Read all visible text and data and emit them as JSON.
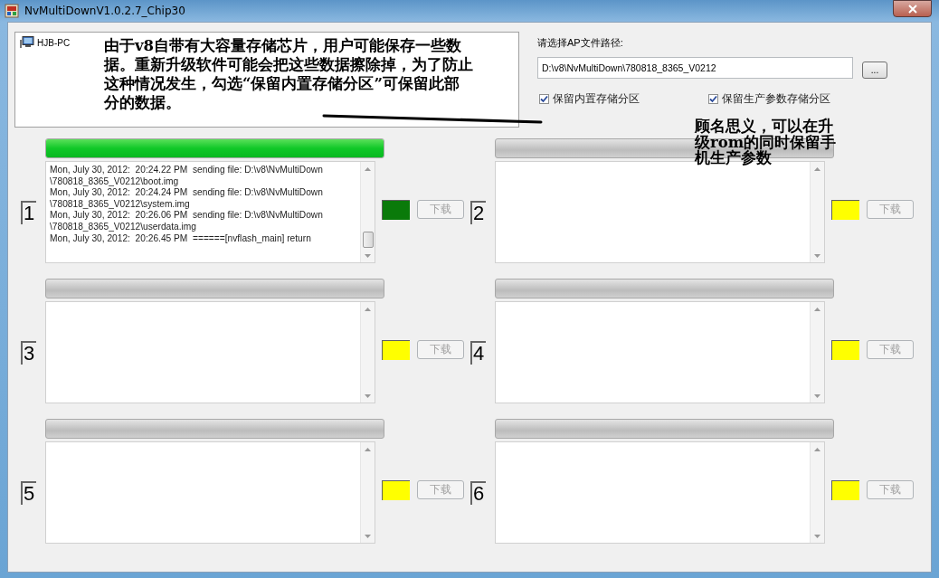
{
  "window": {
    "title": "NvMultiDownV1.0.2.7_Chip30"
  },
  "device_tree": {
    "items": [
      {
        "label": "HJB-PC"
      }
    ]
  },
  "path_label": "请选择AP文件路径:",
  "path_field": {
    "value": "D:\\v8\\NvMultiDown\\780818_8365_V0212"
  },
  "browse_button": "...",
  "options": [
    {
      "label": "保留内置存储分区",
      "checked": true
    },
    {
      "label": "保留生产参数存储分区",
      "checked": true
    }
  ],
  "slots": [
    {
      "number": "1",
      "level": 1,
      "log": [
        "Mon, July 30, 2012:  20:24.22 PM  sending file: D:\\v8\\NvMultiDown",
        "\\780818_8365_V0212\\boot.img",
        "Mon, July 30, 2012:  20:24.24 PM  sending file: D:\\v8\\NvMultiDown",
        "\\780818_8365_V0212\\system.img",
        "Mon, July 30, 2012:  20:26.06 PM  sending file: D:\\v8\\NvMultiDown",
        "\\780818_8365_V0212\\userdata.img",
        "Mon, July 30, 2012:  20:26.45 PM  ======[nvflash_main] return"
      ],
      "color": "#0a7a0a",
      "button": {
        "label": "下载",
        "disabled": true
      }
    },
    {
      "number": "2",
      "level": 0,
      "color": "#ffff00",
      "button": {
        "label": "下载",
        "disabled": true
      }
    },
    {
      "number": "3",
      "level": 0,
      "color": "#ffff00",
      "button": {
        "label": "下载",
        "disabled": true
      }
    },
    {
      "number": "4",
      "level": 0,
      "color": "#ffff00",
      "button": {
        "label": "下载",
        "disabled": true
      }
    },
    {
      "number": "5",
      "level": 0,
      "color": "#ffff00",
      "button": {
        "label": "下载",
        "disabled": true
      }
    },
    {
      "number": "6",
      "level": 0,
      "color": "#ffff00",
      "button": {
        "label": "下载",
        "disabled": true
      }
    }
  ],
  "annotations": [
    {
      "kind": "note",
      "text": "由于v8自带有大容量存储芯片，用户可能保存一些数据。重新升级软件可能会把这些数据擦除掉，为了防止这种情况发生，勾选“保留内置存储分区”可保留此部分的数据。"
    },
    {
      "kind": "note",
      "text": "顾名思义，可以在升级rom的同时保留手机生产参数"
    }
  ]
}
